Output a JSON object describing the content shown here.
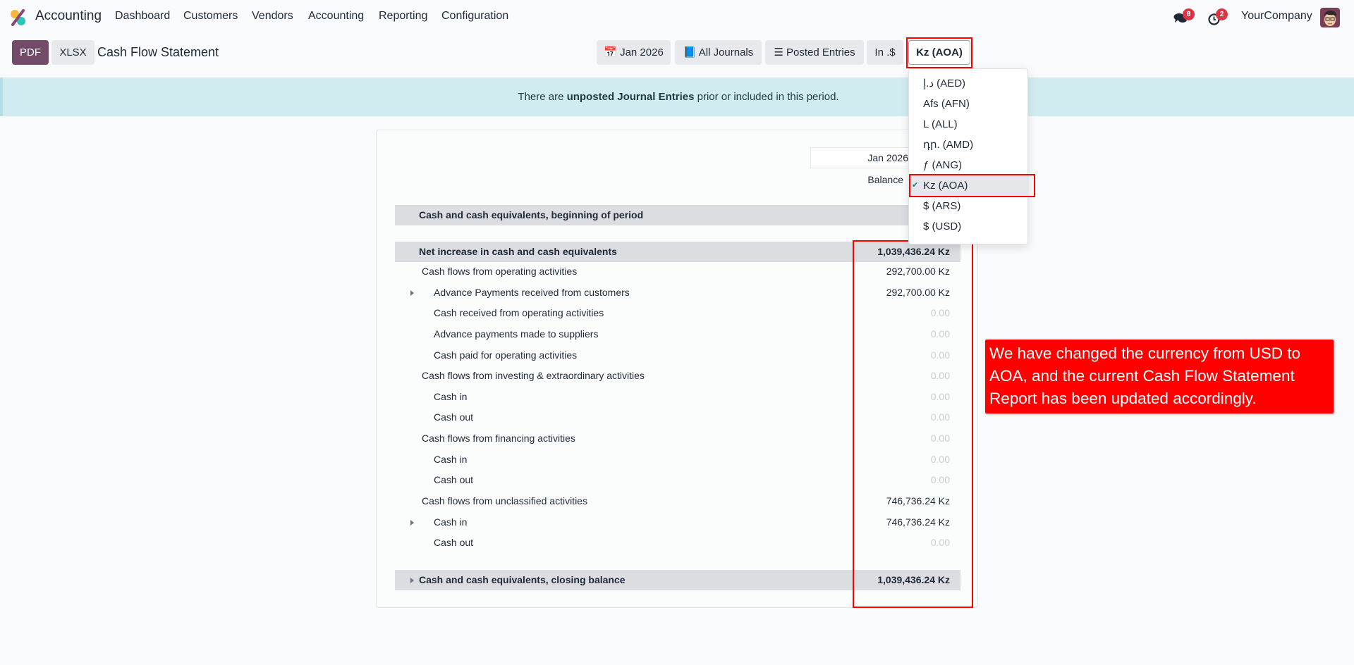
{
  "navbar": {
    "app_name": "Accounting",
    "menu": [
      "Dashboard",
      "Customers",
      "Vendors",
      "Accounting",
      "Reporting",
      "Configuration"
    ],
    "messages_count": "8",
    "activities_count": "2",
    "company": "YourCompany"
  },
  "controls": {
    "pdf": "PDF",
    "xlsx": "XLSX",
    "title": "Cash Flow Statement",
    "date_filter": "Jan 2026",
    "journals_filter": "All Journals",
    "entries_filter": "Posted Entries",
    "rounding_filter": "In .$",
    "currency_filter": "Kz (AOA)"
  },
  "alert": {
    "prefix": "There are ",
    "bold": "unposted Journal Entries",
    "suffix": " prior or included in this period."
  },
  "currency_dropdown": {
    "options": [
      "د.إ (AED)",
      "Afs (AFN)",
      "L (ALL)",
      "դր. (AMD)",
      "ƒ (ANG)",
      "Kz (AOA)",
      "$ (ARS)",
      "$ (USD)"
    ],
    "selected": "Kz (AOA)"
  },
  "report": {
    "column_period": "Jan 2026",
    "column_label": "Balance",
    "rows": [
      {
        "label": "Cash and cash equivalents, beginning of period",
        "value": ""
      },
      {
        "label": "Net increase in cash and cash equivalents",
        "value": "1,039,436.24 Kz"
      },
      {
        "label": "Cash flows from operating activities",
        "value": "292,700.00 Kz"
      },
      {
        "label": "Advance Payments received from customers",
        "value": "292,700.00 Kz"
      },
      {
        "label": "Cash received from operating activities",
        "value": "0.00"
      },
      {
        "label": "Advance payments made to suppliers",
        "value": "0.00"
      },
      {
        "label": "Cash paid for operating activities",
        "value": "0.00"
      },
      {
        "label": "Cash flows from investing & extraordinary activities",
        "value": "0.00"
      },
      {
        "label": "Cash in",
        "value": "0.00"
      },
      {
        "label": "Cash out",
        "value": "0.00"
      },
      {
        "label": "Cash flows from financing activities",
        "value": "0.00"
      },
      {
        "label": "Cash in",
        "value": "0.00"
      },
      {
        "label": "Cash out",
        "value": "0.00"
      },
      {
        "label": "Cash flows from unclassified activities",
        "value": "746,736.24 Kz"
      },
      {
        "label": "Cash in",
        "value": "746,736.24 Kz"
      },
      {
        "label": "Cash out",
        "value": "0.00"
      },
      {
        "label": "Cash and cash equivalents, closing balance",
        "value": "1,039,436.24 Kz"
      }
    ]
  },
  "annotation": "We have changed the currency from USD to AOA, and the current Cash Flow Statement Report has been updated accordingly.",
  "colors": {
    "accent": "#714b67",
    "highlight": "#ff0000",
    "alert_bg": "#d1ecf1",
    "badge": "#dc3545"
  }
}
